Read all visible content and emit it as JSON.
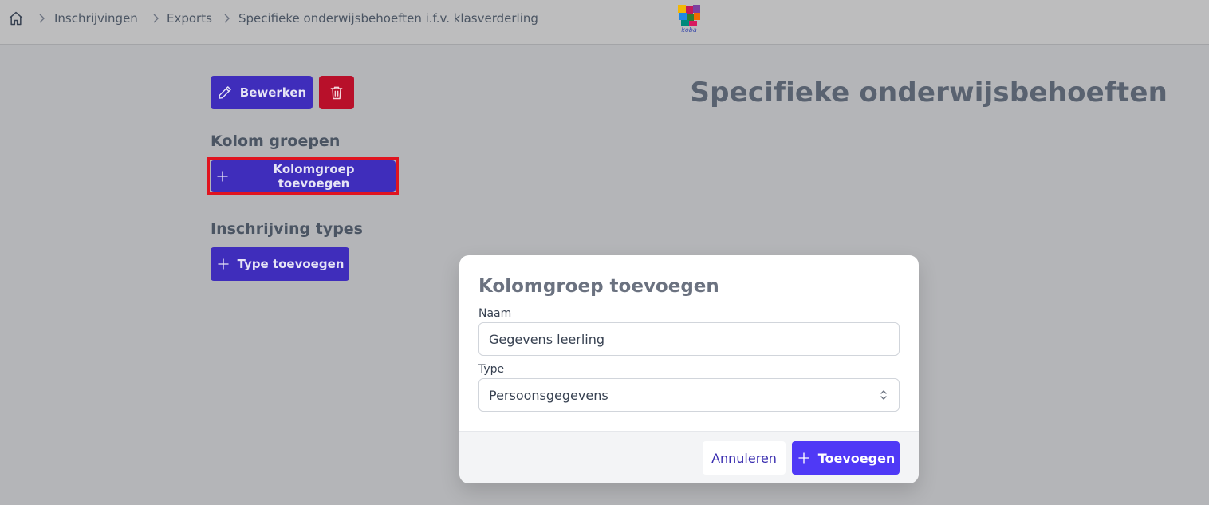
{
  "breadcrumb": {
    "home_icon": "home-icon",
    "items": [
      "Inschrijvingen",
      "Exports",
      "Specifieke onderwijsbehoeften i.f.v. klasverderling"
    ]
  },
  "logo": {
    "text": "koba"
  },
  "toolbar": {
    "edit_label": "Bewerken",
    "delete_icon": "trash-icon"
  },
  "page_title": "Specifieke onderwijsbehoeften",
  "sections": {
    "kolom_groepen": {
      "title": "Kolom groepen",
      "add_label": "Kolomgroep toevoegen"
    },
    "inschrijving_types": {
      "title": "Inschrijving types",
      "add_label": "Type toevoegen"
    }
  },
  "modal": {
    "title": "Kolomgroep toevoegen",
    "name_label": "Naam",
    "name_value": "Gegevens leerling",
    "type_label": "Type",
    "type_value": "Persoonsgegevens",
    "cancel_label": "Annuleren",
    "submit_label": "Toevoegen"
  },
  "colors": {
    "primary": "#3f2dbb",
    "danger": "#b8102a",
    "submit": "#4f39f6",
    "highlight": "#e0141f"
  }
}
